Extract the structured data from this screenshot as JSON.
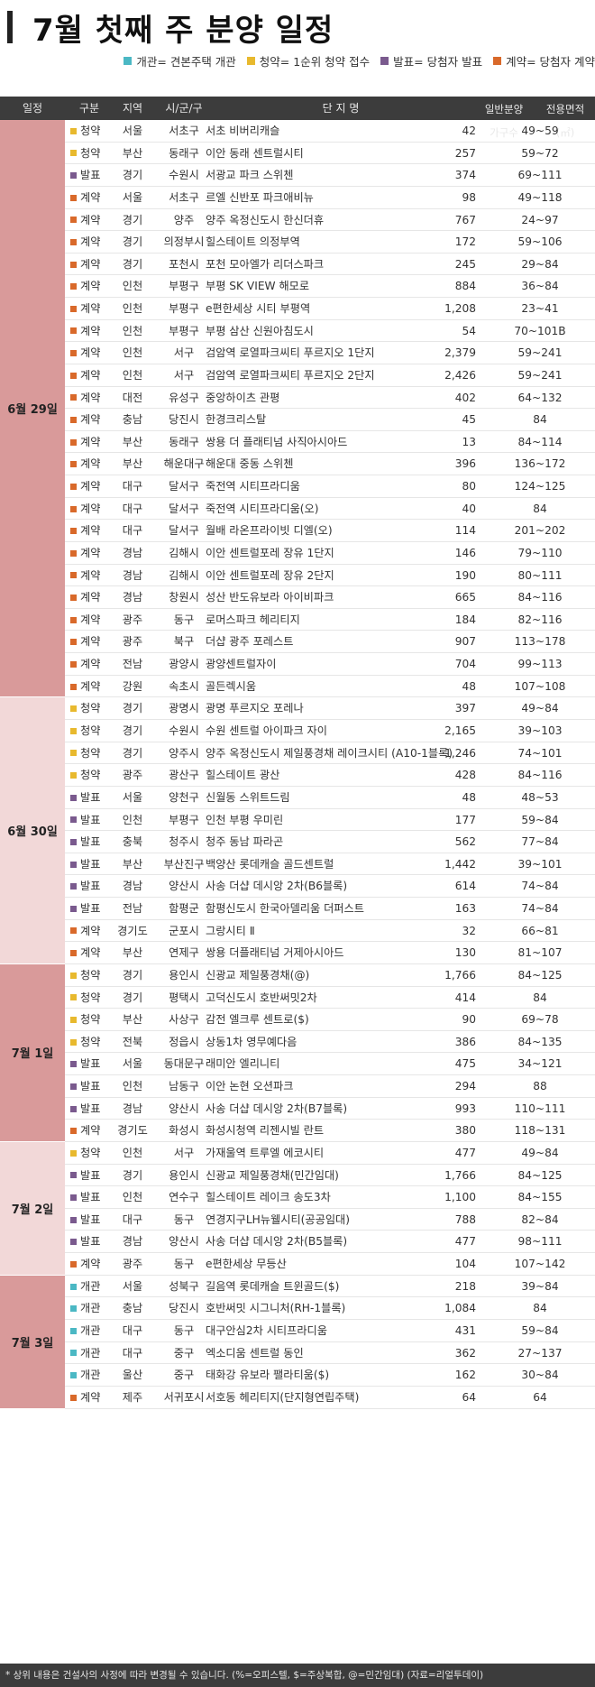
{
  "title": "7월 첫째 주 분양 일정",
  "legend": [
    {
      "text": "개관= 견본주택 개관",
      "color": "#4bb8c4"
    },
    {
      "text": "청약= 1순위 청약 접수",
      "color": "#e8b92e"
    },
    {
      "text": "발표= 당첨자 발표",
      "color": "#7a5a8e"
    },
    {
      "text": "계약= 당첨자 계약",
      "color": "#d9692a"
    }
  ],
  "colors": {
    "개관": "#4bb8c4",
    "청약": "#e8b92e",
    "발표": "#7a5a8e",
    "계약": "#d9692a"
  },
  "header": {
    "date": "일정",
    "type": "구분",
    "region": "지역",
    "city": "시/군/구",
    "name": "단 지 명",
    "units_l1": "일반분양",
    "units_l2": "가구수",
    "area_l1": "전용면적",
    "area_l2": "(㎡)"
  },
  "groups": [
    {
      "date": "6월 29일",
      "color": "#d99a9a",
      "rows": [
        [
          "청약",
          "서울",
          "서초구",
          "서초 비버리캐슬",
          "42",
          "49~59"
        ],
        [
          "청약",
          "부산",
          "동래구",
          "이안 동래 센트럴시티",
          "257",
          "59~72"
        ],
        [
          "발표",
          "경기",
          "수원시",
          "서광교 파크 스위첸",
          "374",
          "69~111"
        ],
        [
          "계약",
          "서울",
          "서초구",
          "르엘 신반포 파크애비뉴",
          "98",
          "49~118"
        ],
        [
          "계약",
          "경기",
          "양주",
          "양주 옥정신도시 한신더휴",
          "767",
          "24~97"
        ],
        [
          "계약",
          "경기",
          "의정부시",
          "힐스테이트 의정부역",
          "172",
          "59~106"
        ],
        [
          "계약",
          "경기",
          "포천시",
          "포천 모아엘가 리더스파크",
          "245",
          "29~84"
        ],
        [
          "계약",
          "인천",
          "부평구",
          "부평 SK VIEW 해모로",
          "884",
          "36~84"
        ],
        [
          "계약",
          "인천",
          "부평구",
          "e편한세상 시티 부평역",
          "1,208",
          "23~41"
        ],
        [
          "계약",
          "인천",
          "부평구",
          "부평 삼산 신원아침도시",
          "54",
          "70~101B"
        ],
        [
          "계약",
          "인천",
          "서구",
          "검암역 로열파크씨티 푸르지오 1단지",
          "2,379",
          "59~241"
        ],
        [
          "계약",
          "인천",
          "서구",
          "검암역 로열파크씨티 푸르지오 2단지",
          "2,426",
          "59~241"
        ],
        [
          "계약",
          "대전",
          "유성구",
          "중앙하이츠 관평",
          "402",
          "64~132"
        ],
        [
          "계약",
          "충남",
          "당진시",
          "한경크리스탈",
          "45",
          "84"
        ],
        [
          "계약",
          "부산",
          "동래구",
          "쌍용 더 플래티넘 사직아시아드",
          "13",
          "84~114"
        ],
        [
          "계약",
          "부산",
          "해운대구",
          "해운대 중동 스위첸",
          "396",
          "136~172"
        ],
        [
          "계약",
          "대구",
          "달서구",
          "죽전역 시티프라디움",
          "80",
          "124~125"
        ],
        [
          "계약",
          "대구",
          "달서구",
          "죽전역 시티프라디움(오)",
          "40",
          "84"
        ],
        [
          "계약",
          "대구",
          "달서구",
          "월배 라온프라이빗 디엘(오)",
          "114",
          "201~202"
        ],
        [
          "계약",
          "경남",
          "김해시",
          "이안 센트럴포레 장유 1단지",
          "146",
          "79~110"
        ],
        [
          "계약",
          "경남",
          "김해시",
          "이안 센트럴포레 장유 2단지",
          "190",
          "80~111"
        ],
        [
          "계약",
          "경남",
          "창원시",
          "성산 반도유보라 아이비파크",
          "665",
          "84~116"
        ],
        [
          "계약",
          "광주",
          "동구",
          "로머스파크 헤리티지",
          "184",
          "82~116"
        ],
        [
          "계약",
          "광주",
          "북구",
          "더샵 광주 포레스트",
          "907",
          "113~178"
        ],
        [
          "계약",
          "전남",
          "광양시",
          "광양센트럴자이",
          "704",
          "99~113"
        ],
        [
          "계약",
          "강원",
          "속초시",
          "골든렉시움",
          "48",
          "107~108"
        ]
      ]
    },
    {
      "date": "6월 30일",
      "color": "#f2d8d8",
      "rows": [
        [
          "청약",
          "경기",
          "광명시",
          "광명 푸르지오 포레나",
          "397",
          "49~84"
        ],
        [
          "청약",
          "경기",
          "수원시",
          "수원 센트럴 아이파크 자이",
          "2,165",
          "39~103"
        ],
        [
          "청약",
          "경기",
          "양주시",
          "양주 옥정신도시 제일풍경채 레이크시티 (A10-1블록)",
          "1,246",
          "74~101"
        ],
        [
          "청약",
          "광주",
          "광산구",
          "힐스테이트 광산",
          "428",
          "84~116"
        ],
        [
          "발표",
          "서울",
          "양천구",
          "신월동 스위트드림",
          "48",
          "48~53"
        ],
        [
          "발표",
          "인천",
          "부평구",
          "인천 부평 우미린",
          "177",
          "59~84"
        ],
        [
          "발표",
          "충북",
          "청주시",
          "청주 동남 파라곤",
          "562",
          "77~84"
        ],
        [
          "발표",
          "부산",
          "부산진구",
          "백양산 롯데캐슬 골드센트럴",
          "1,442",
          "39~101"
        ],
        [
          "발표",
          "경남",
          "양산시",
          "사송 더샵 데시앙 2차(B6블록)",
          "614",
          "74~84"
        ],
        [
          "발표",
          "전남",
          "함평군",
          "함평신도시 한국아델리움 더퍼스트",
          "163",
          "74~84"
        ],
        [
          "계약",
          "경기도",
          "군포시",
          "그랑시티 Ⅱ",
          "32",
          "66~81"
        ],
        [
          "계약",
          "부산",
          "연제구",
          "쌍용 더플래티넘 거제아시아드",
          "130",
          "81~107"
        ]
      ]
    },
    {
      "date": "7월 1일",
      "color": "#d99a9a",
      "rows": [
        [
          "청약",
          "경기",
          "용인시",
          "신광교 제일풍경채(@)",
          "1,766",
          "84~125"
        ],
        [
          "청약",
          "경기",
          "평택시",
          "고덕신도시 호반써밋2차",
          "414",
          "84"
        ],
        [
          "청약",
          "부산",
          "사상구",
          "감전 엘크루 센트로($)",
          "90",
          "69~78"
        ],
        [
          "청약",
          "전북",
          "정읍시",
          "상동1차 영무예다음",
          "386",
          "84~135"
        ],
        [
          "발표",
          "서울",
          "동대문구",
          "래미안 엘리니티",
          "475",
          "34~121"
        ],
        [
          "발표",
          "인천",
          "남동구",
          "이안 논현 오션파크",
          "294",
          "88"
        ],
        [
          "발표",
          "경남",
          "양산시",
          "사송 더샵 데시앙 2차(B7블록)",
          "993",
          "110~111"
        ],
        [
          "계약",
          "경기도",
          "화성시",
          "화성시청역 리젠시빌 란트",
          "380",
          "118~131"
        ]
      ]
    },
    {
      "date": "7월 2일",
      "color": "#f2d8d8",
      "rows": [
        [
          "청약",
          "인천",
          "서구",
          "가재울역 트루엘 에코시티",
          "477",
          "49~84"
        ],
        [
          "발표",
          "경기",
          "용인시",
          "신광교 제일풍경채(민간임대)",
          "1,766",
          "84~125"
        ],
        [
          "발표",
          "인천",
          "연수구",
          "힐스테이트 레이크 송도3차",
          "1,100",
          "84~155"
        ],
        [
          "발표",
          "대구",
          "동구",
          "연경지구LH뉴웰시티(공공임대)",
          "788",
          "82~84"
        ],
        [
          "발표",
          "경남",
          "양산시",
          "사송 더샵 데시앙 2차(B5블록)",
          "477",
          "98~111"
        ],
        [
          "계약",
          "광주",
          "동구",
          "e편한세상 무등산",
          "104",
          "107~142"
        ]
      ]
    },
    {
      "date": "7월 3일",
      "color": "#d99a9a",
      "rows": [
        [
          "개관",
          "서울",
          "성북구",
          "길음역 롯데캐슬 트윈골드($)",
          "218",
          "39~84"
        ],
        [
          "개관",
          "충남",
          "당진시",
          "호반써밋 시그니처(RH-1블록)",
          "1,084",
          "84"
        ],
        [
          "개관",
          "대구",
          "동구",
          "대구안심2차 시티프라디움",
          "431",
          "59~84"
        ],
        [
          "개관",
          "대구",
          "중구",
          "엑소디움 센트럴 동인",
          "362",
          "27~137"
        ],
        [
          "개관",
          "울산",
          "중구",
          "태화강 유보라 팰라티움($)",
          "162",
          "30~84"
        ],
        [
          "계약",
          "제주",
          "서귀포시",
          "서호동 헤리티지(단지형연립주택)",
          "64",
          "64"
        ]
      ]
    }
  ],
  "footer": "* 상위 내용은 건설사의 사정에 따라 변경될 수 있습니다. (%=오피스텔, $=주상복합, @=민간임대) (자료=리얼투데이)"
}
